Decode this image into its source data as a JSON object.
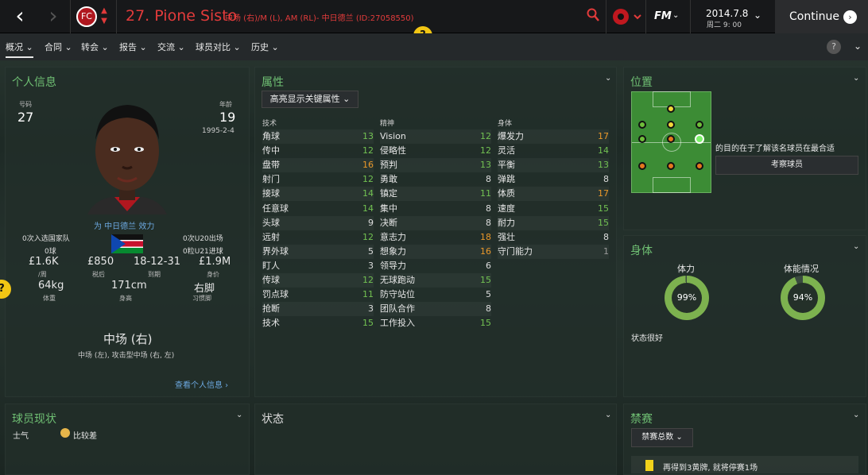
{
  "header": {
    "back": "‹",
    "forward": "›",
    "badge": "FC",
    "name": "27. Pione Sisto",
    "desc": "中场 (右)/M (L), AM (RL)- 中日德兰 (ID:27058550)",
    "logo": "FM",
    "date": "2014.7.8",
    "time": "周二 9: 00",
    "continue": "Continue",
    "continue_icon": "›",
    "help": "?"
  },
  "colors": {
    "accent": "#6fbf73",
    "club_red": "#e23b3b",
    "good": "#72c152",
    "high": "#e8972a",
    "help_yellow": "#f2c614"
  },
  "menu": {
    "items": [
      "概况",
      "合同",
      "转会",
      "报告",
      "交流",
      "球员对比",
      "历史"
    ],
    "help": "?"
  },
  "personal": {
    "title": "个人信息",
    "number_label": "号码",
    "number": "27",
    "age_label": "年龄",
    "age": "19",
    "dob": "1995-2-4",
    "club_line": "为 中日德兰 效力",
    "caps": "0次入选国家队",
    "goals": "0球",
    "u20": "0次U20出场",
    "u21": "0粒U21进球",
    "wage": "£1.6K",
    "wage_label": "/周",
    "tax": "£850",
    "tax_label": "税后",
    "expires": "18-12-31",
    "expires_label": "到期",
    "value": "£1.9M",
    "value_label": "身价",
    "weight": "64kg",
    "weight_label": "体重",
    "height": "171cm",
    "height_label": "身高",
    "foot": "右脚",
    "foot_label": "习惯脚",
    "position": "中场 (右)",
    "positions": "中场 (左), 攻击型中场 (右, 左)",
    "more": "查看个人信息 ›"
  },
  "attributes": {
    "title": "属性",
    "filter": "高亮显示关键属性",
    "col_tech": "技术",
    "col_mental": "精神",
    "col_phys": "身体",
    "tech": [
      {
        "n": "角球",
        "v": "13"
      },
      {
        "n": "传中",
        "v": "12"
      },
      {
        "n": "盘带",
        "v": "16"
      },
      {
        "n": "射门",
        "v": "12"
      },
      {
        "n": "接球",
        "v": "14"
      },
      {
        "n": "任意球",
        "v": "14"
      },
      {
        "n": "头球",
        "v": "9"
      },
      {
        "n": "远射",
        "v": "12"
      },
      {
        "n": "界外球",
        "v": "5"
      },
      {
        "n": "盯人",
        "v": "3"
      },
      {
        "n": "传球",
        "v": "12"
      },
      {
        "n": "罚点球",
        "v": "11"
      },
      {
        "n": "抢断",
        "v": "3"
      },
      {
        "n": "技术",
        "v": "15"
      }
    ],
    "mental": [
      {
        "n": "Vision",
        "v": "12"
      },
      {
        "n": "侵略性",
        "v": "12"
      },
      {
        "n": "预判",
        "v": "13"
      },
      {
        "n": "勇敢",
        "v": "8"
      },
      {
        "n": "镇定",
        "v": "11"
      },
      {
        "n": "集中",
        "v": "8"
      },
      {
        "n": "决断",
        "v": "8"
      },
      {
        "n": "意志力",
        "v": "18"
      },
      {
        "n": "想象力",
        "v": "16"
      },
      {
        "n": "领导力",
        "v": "6"
      },
      {
        "n": "无球跑动",
        "v": "15"
      },
      {
        "n": "防守站位",
        "v": "5"
      },
      {
        "n": "团队合作",
        "v": "8"
      },
      {
        "n": "工作投入",
        "v": "15"
      }
    ],
    "phys": [
      {
        "n": "爆发力",
        "v": "17"
      },
      {
        "n": "灵活",
        "v": "14"
      },
      {
        "n": "平衡",
        "v": "13"
      },
      {
        "n": "弹跳",
        "v": "8"
      },
      {
        "n": "体质",
        "v": "17"
      },
      {
        "n": "速度",
        "v": "15"
      },
      {
        "n": "耐力",
        "v": "15"
      },
      {
        "n": "强壮",
        "v": "8"
      },
      {
        "n": "守门能力",
        "v": "1"
      }
    ]
  },
  "position_panel": {
    "title": "位置",
    "note": "的目的在于了解该名球员在最合适",
    "button": "考察球员"
  },
  "body": {
    "title": "身体",
    "stamina_label": "体力",
    "stamina": "99%",
    "stamina_level": 0.99,
    "cond_label": "体能情况",
    "cond": "94%",
    "cond_level": 0.94,
    "status": "状态很好"
  },
  "status_panel": {
    "title": "球员现状",
    "morale_label": "士气",
    "morale": "比较差"
  },
  "form": {
    "title": "状态"
  },
  "bans": {
    "title": "禁赛",
    "filter": "禁赛总数",
    "line": "再得到3黄牌, 就将停赛1场"
  }
}
